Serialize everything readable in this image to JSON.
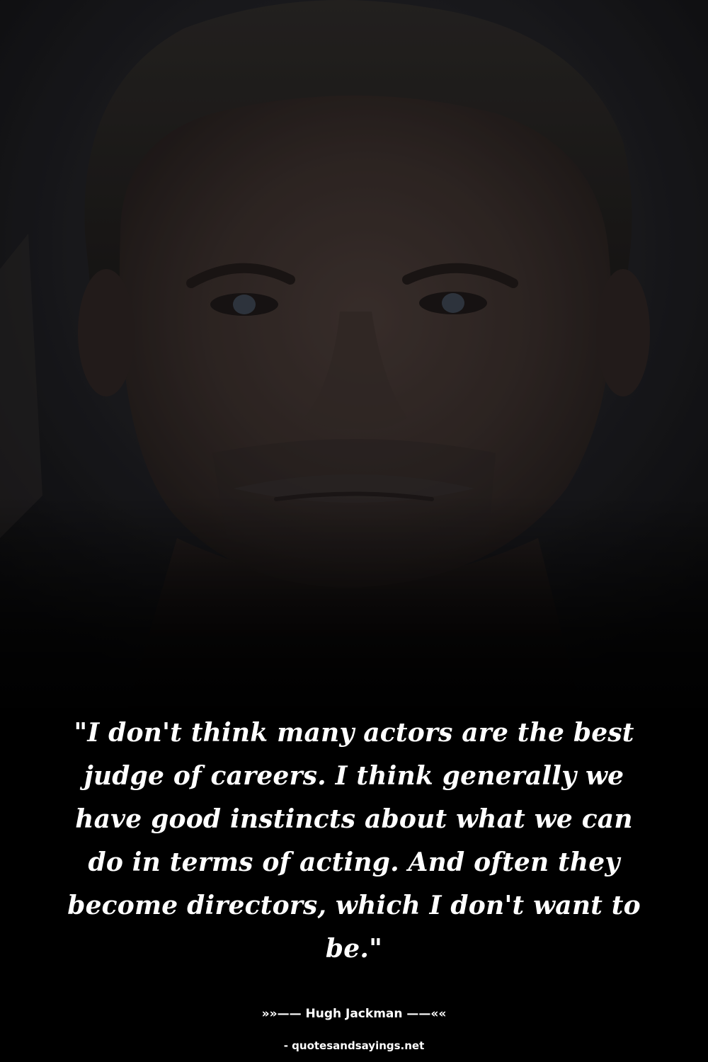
{
  "quote": {
    "text": "\"I don't think many actors are the best judge of careers. I think generally we have good instincts about what we can do in terms of acting. And often they become directors, which I don't want to be.\""
  },
  "attribution": {
    "author_line": "»»—— Hugh Jackman ——««"
  },
  "watermark": {
    "text": "- quotesandsayings.net"
  },
  "photo": {
    "subject": "portrait-photo",
    "overlay": "dark-tint"
  }
}
